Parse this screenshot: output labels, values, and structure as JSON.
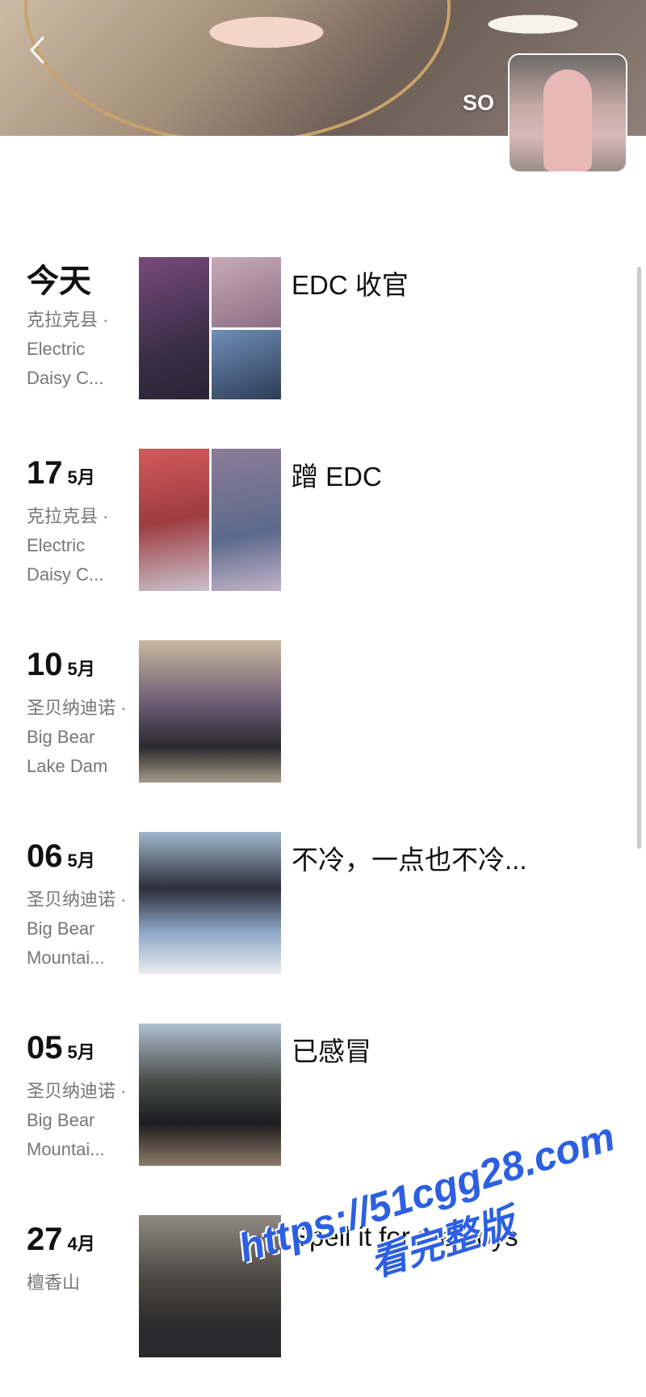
{
  "profile": {
    "nickname": "SO"
  },
  "posts": [
    {
      "day": "今天",
      "month": "",
      "location": "克拉克县 · Electric Daisy C...",
      "caption": "EDC 收官",
      "photos": 3,
      "colors": [
        "#4b3b5a",
        "#b89aa8",
        "#4e6f96"
      ]
    },
    {
      "day": "17",
      "month": "5月",
      "location": "克拉克县 · Electric Daisy C...",
      "caption": "蹭 EDC",
      "photos": 2,
      "colors": [
        "#b14e4e",
        "#6d6f86"
      ]
    },
    {
      "day": "10",
      "month": "5月",
      "location": "圣贝纳迪诺 · Big Bear Lake Dam",
      "caption": "",
      "photos": 1,
      "colors": [
        "#8b7a6a"
      ]
    },
    {
      "day": "06",
      "month": "5月",
      "location": "圣贝纳迪诺 · Big Bear Mountai...",
      "caption": "不冷，一点也不冷...",
      "photos": 1,
      "colors": [
        "#5e7a93"
      ]
    },
    {
      "day": "05",
      "month": "5月",
      "location": "圣贝纳迪诺 · Big Bear Mountai...",
      "caption": "已感冒",
      "photos": 1,
      "colors": [
        "#6e6a60"
      ]
    },
    {
      "day": "27",
      "month": "4月",
      "location": "檀香山",
      "caption": "Spell it for me boys",
      "photos": 1,
      "colors": [
        "#5d5a55"
      ]
    }
  ],
  "watermark": {
    "url": "https://51cgg28.com",
    "text": "看完整版"
  }
}
